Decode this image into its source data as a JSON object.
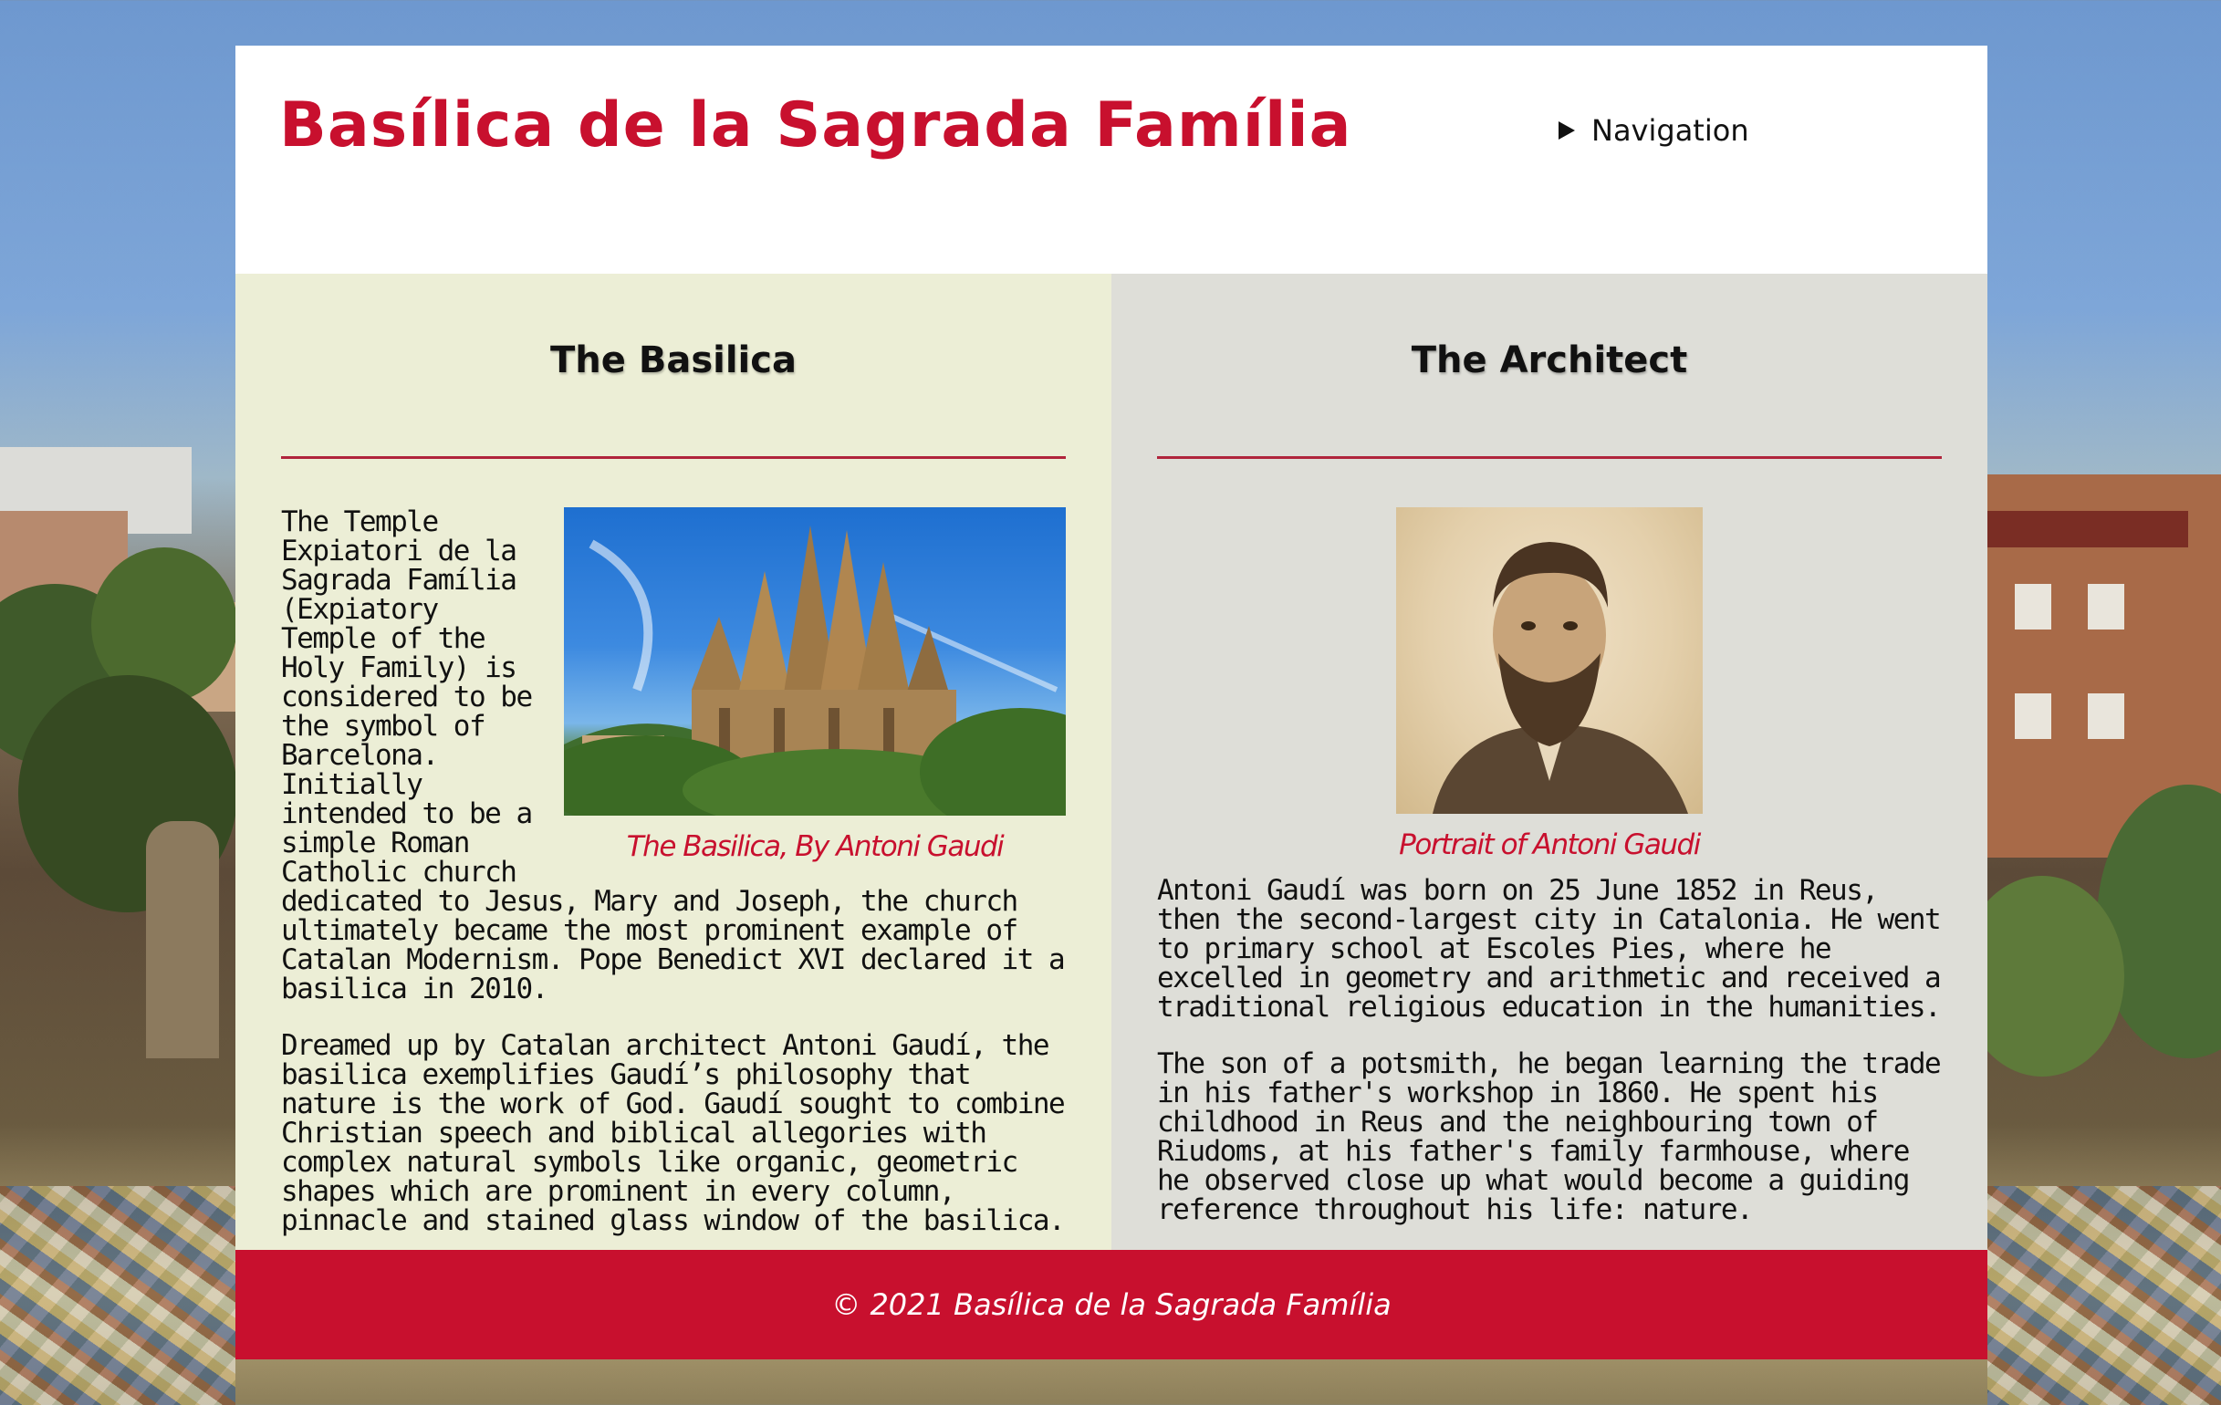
{
  "header": {
    "title": "Basílica de la Sagrada Família",
    "nav_label": "Navigation"
  },
  "basilica": {
    "heading": "The Basilica",
    "image_caption": "The Basilica, By Antoni Gaudi",
    "paragraphs": [
      "The Temple Expiatori de la Sagrada Família (Expiatory Temple of the Holy Family) is considered to be the symbol of Barcelona. Initially intended to be a simple Roman Catholic church dedicated to Jesus, Mary and Joseph, the church ultimately became the most prominent example of Catalan Modernism. Pope Benedict XVI declared it a basilica in 2010.",
      "Dreamed up by Catalan architect Antoni Gaudí, the basilica exemplifies Gaudí’s philosophy that nature is the work of God. Gaudí sought to combine Christian speech and biblical allegories with complex natural symbols like organic, geometric shapes which are prominent in every column, pinnacle and stained glass window of the basilica."
    ]
  },
  "architect": {
    "heading": "The Architect",
    "image_caption": "Portrait of Antoni Gaudi",
    "paragraphs": [
      "Antoni Gaudí was born on 25 June 1852 in Reus, then the second-largest city in Catalonia. He went to primary school at Escoles Pies, where he excelled in geometry and arithmetic and received a traditional religious education in the humanities.",
      "The son of a potsmith, he began learning the trade in his father's workshop in 1860. He spent his childhood in Reus and the neighbouring town of Riudoms, at his father's family farmhouse, where he observed close up what would become a guiding reference throughout his life: nature."
    ]
  },
  "footer": {
    "text": "© 2021 Basílica de la Sagrada Família"
  },
  "colors": {
    "brand_red": "#c8102e",
    "left_panel": "#eceed6",
    "right_panel": "#deded8"
  }
}
